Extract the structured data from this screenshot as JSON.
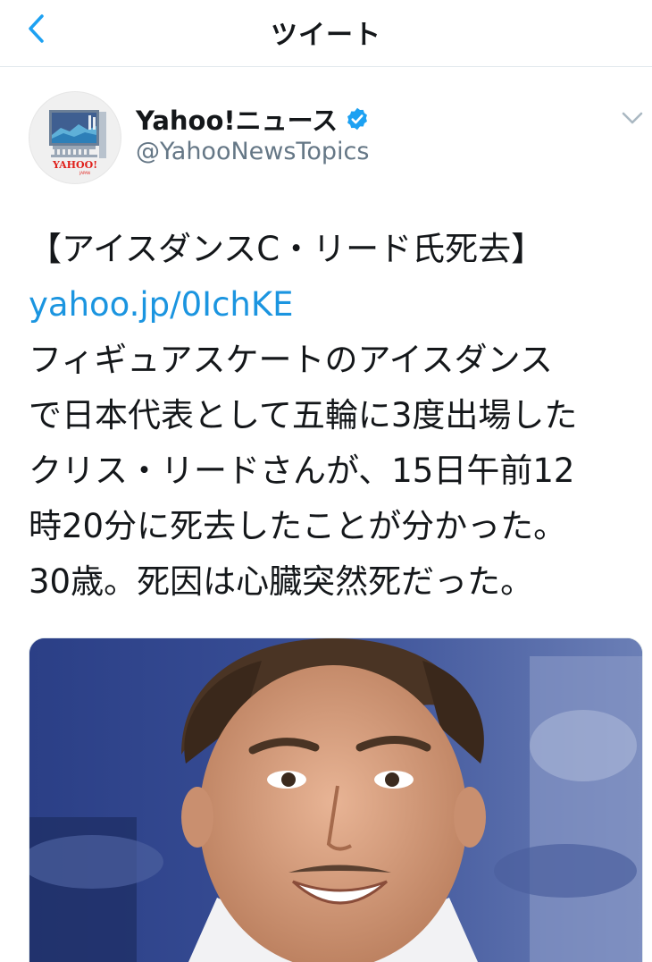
{
  "header": {
    "title": "ツイート"
  },
  "author": {
    "name": "Yahoo!ニュース",
    "handle": "@YahooNewsTopics",
    "avatar_logo_text": "YAHOO!",
    "avatar_logo_sub": "JAPAN"
  },
  "tweet": {
    "headline": "【アイスダンスC・リード氏死去】",
    "link": "yahoo.jp/0IchKE",
    "body_lines": [
      "フィギュアスケートのアイスダンス",
      "で日本代表として五輪に3度出場した",
      "クリス・リードさんが、15日午前12",
      "時20分に死去したことが分かった。",
      "30歳。死因は心臓突然死だった。"
    ]
  },
  "colors": {
    "link": "#1b95e0",
    "verified": "#1da1f2",
    "secondary_text": "#657786"
  },
  "icons": {
    "back": "chevron-left-icon",
    "verified": "verified-badge-icon",
    "more": "chevron-down-icon"
  }
}
